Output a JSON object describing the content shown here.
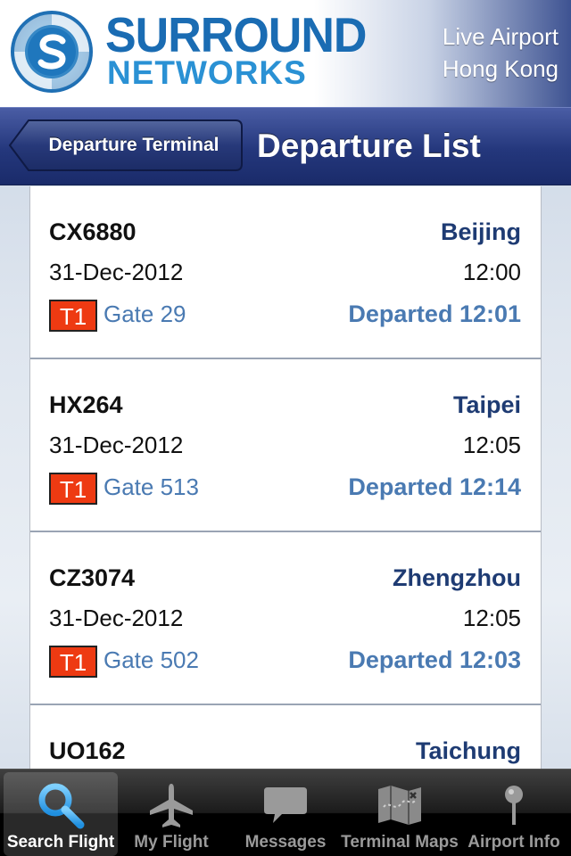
{
  "header": {
    "brand_line1": "SURROUND",
    "brand_line2": "NETWORKS",
    "subtitle_line1": "Live Airport",
    "subtitle_line2": "Hong Kong",
    "logo_icon": "swirl-logo-icon"
  },
  "navbar": {
    "back_label": "Departure Terminal",
    "title": "Departure List"
  },
  "flights": [
    {
      "flight_no": "CX6880",
      "destination": "Beijing",
      "date": "31-Dec-2012",
      "time": "12:00",
      "terminal": "T1",
      "gate": "Gate 29",
      "status": "Departed 12:01"
    },
    {
      "flight_no": "HX264",
      "destination": "Taipei",
      "date": "31-Dec-2012",
      "time": "12:05",
      "terminal": "T1",
      "gate": "Gate 513",
      "status": "Departed 12:14"
    },
    {
      "flight_no": "CZ3074",
      "destination": "Zhengzhou",
      "date": "31-Dec-2012",
      "time": "12:05",
      "terminal": "T1",
      "gate": "Gate 502",
      "status": "Departed 12:03"
    },
    {
      "flight_no": "UO162",
      "destination": "Taichung"
    }
  ],
  "tabs": [
    {
      "label": "Search Flight",
      "icon": "magnifier-icon",
      "active": true
    },
    {
      "label": "My Flight",
      "icon": "airplane-icon",
      "active": false
    },
    {
      "label": "Messages",
      "icon": "speech-bubble-icon",
      "active": false
    },
    {
      "label": "Terminal Maps",
      "icon": "map-icon",
      "active": false
    },
    {
      "label": "Airport Info",
      "icon": "pin-icon",
      "active": false
    }
  ],
  "colors": {
    "brand_dark_blue": "#1a6cb3",
    "brand_light_blue": "#2a91d4",
    "nav_blue": "#24377c",
    "destination_blue": "#1e3b73",
    "gate_blue": "#4a7ab2",
    "terminal_badge": "#ee3a12"
  }
}
